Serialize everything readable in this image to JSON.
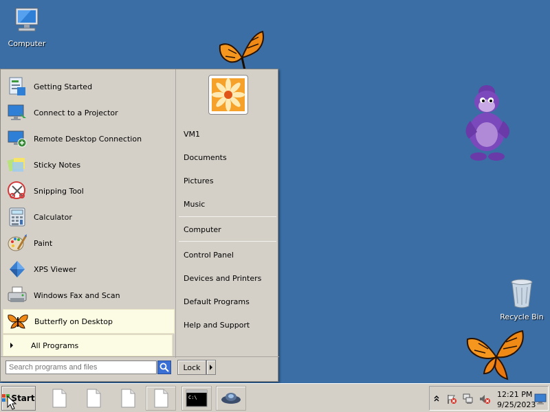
{
  "desktop": {
    "computer_label": "Computer",
    "recycle_bin_label": "Recycle Bin"
  },
  "start_menu": {
    "programs": [
      {
        "label": "Getting Started",
        "icon": "getting-started-icon"
      },
      {
        "label": "Connect to a Projector",
        "icon": "projector-icon"
      },
      {
        "label": "Remote Desktop Connection",
        "icon": "remote-desktop-icon"
      },
      {
        "label": "Sticky Notes",
        "icon": "sticky-notes-icon"
      },
      {
        "label": "Snipping Tool",
        "icon": "snipping-tool-icon"
      },
      {
        "label": "Calculator",
        "icon": "calculator-icon"
      },
      {
        "label": "Paint",
        "icon": "paint-icon"
      },
      {
        "label": "XPS Viewer",
        "icon": "xps-viewer-icon"
      },
      {
        "label": "Windows Fax and Scan",
        "icon": "fax-scan-icon"
      },
      {
        "label": "Butterfly on Desktop",
        "icon": "butterfly-icon"
      }
    ],
    "all_programs_label": "All Programs",
    "search_placeholder": "Search programs and files",
    "right_items": {
      "user": "VM1",
      "documents": "Documents",
      "pictures": "Pictures",
      "music": "Music",
      "computer": "Computer",
      "control_panel": "Control Panel",
      "devices_printers": "Devices and Printers",
      "default_programs": "Default Programs",
      "help_support": "Help and Support"
    },
    "lock_label": "Lock"
  },
  "taskbar": {
    "start_label": "Start",
    "cmd_text": "C:\\",
    "clock_time": "12:21 PM",
    "clock_date": "9/25/2023"
  },
  "colors": {
    "desktop": "#3a6ea5",
    "menu_bg": "#d4d0c8",
    "highlight": "#fcfbe3"
  }
}
